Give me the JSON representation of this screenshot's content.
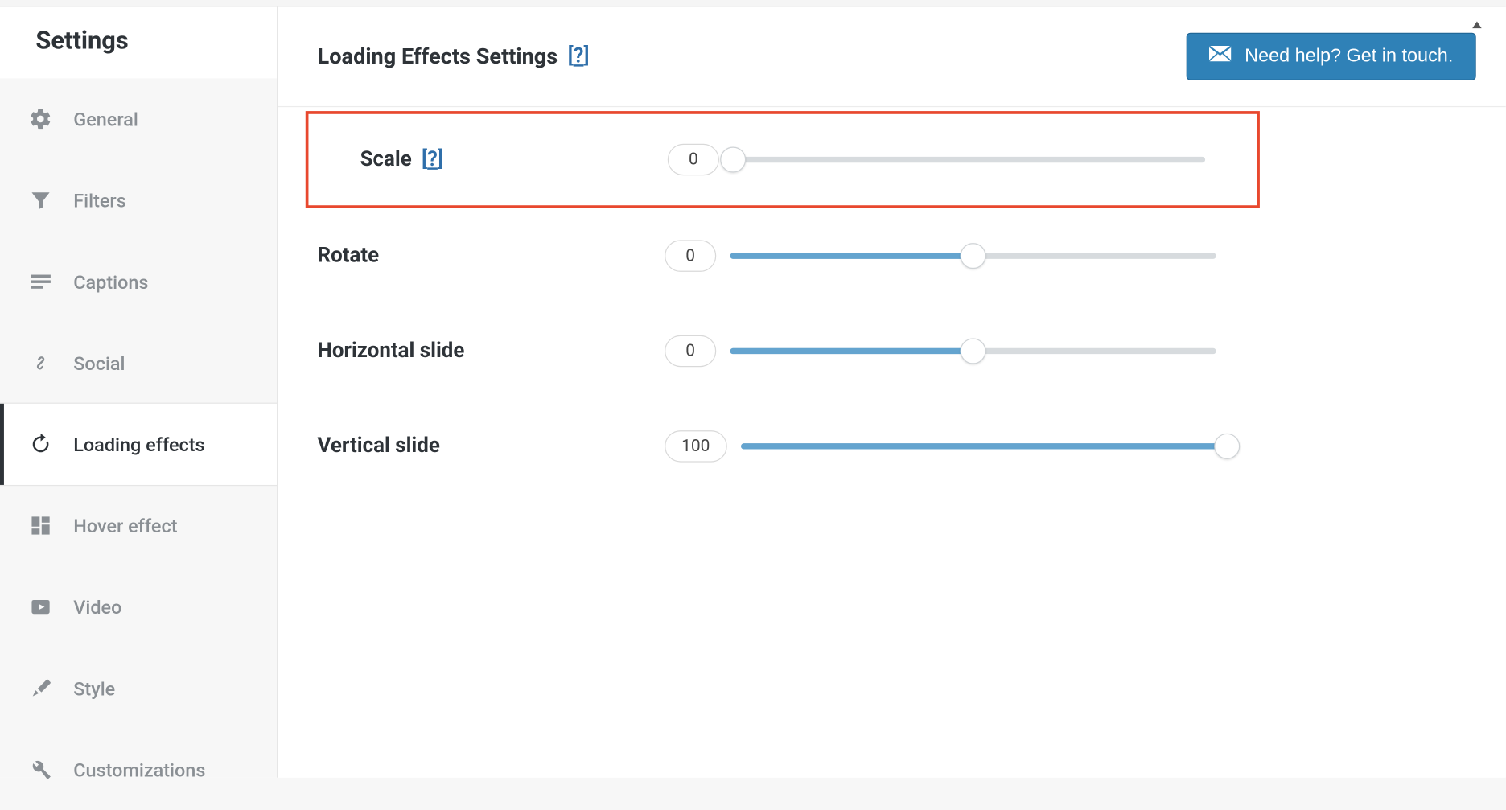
{
  "header": {
    "title": "Settings"
  },
  "sidebar": {
    "items": [
      {
        "label": "General"
      },
      {
        "label": "Filters"
      },
      {
        "label": "Captions"
      },
      {
        "label": "Social"
      },
      {
        "label": "Loading effects"
      },
      {
        "label": "Hover effect"
      },
      {
        "label": "Video"
      },
      {
        "label": "Style"
      },
      {
        "label": "Customizations"
      }
    ]
  },
  "main": {
    "title": "Loading Effects Settings",
    "help_symbol": "?",
    "need_help_label": "Need help? Get in touch."
  },
  "settings": {
    "scale": {
      "label": "Scale",
      "help_symbol": "?",
      "value": "0",
      "percent": 0,
      "highlighted": true
    },
    "rotate": {
      "label": "Rotate",
      "value": "0",
      "percent": 50
    },
    "hslide": {
      "label": "Horizontal slide",
      "value": "0",
      "percent": 50
    },
    "vslide": {
      "label": "Vertical slide",
      "value": "100",
      "percent": 100
    }
  }
}
